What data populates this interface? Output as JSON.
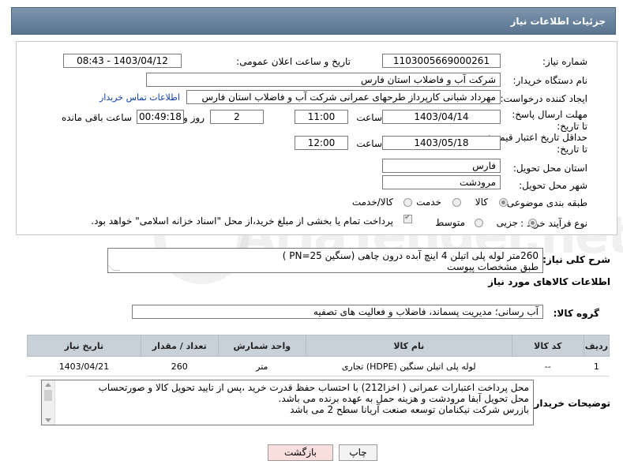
{
  "header": {
    "title": "جزئیات اطلاعات نیاز"
  },
  "form": {
    "need_number_label": "شماره نیاز:",
    "need_number": "1103005669000261",
    "announce_label": "تاریخ و ساعت اعلان عمومی:",
    "announce_value": "1403/04/12 - 08:43",
    "buyer_org_label": "نام دستگاه خریدار:",
    "buyer_org": "شرکت آب و فاضلاب استان فارس",
    "requester_label": "ایجاد کننده درخواست:",
    "requester": "مهرداد شبانی کارپرداز طرحهای عمرانی  شرکت آب و فاضلاب استان فارس",
    "contact_link": "اطلاعات تماس خریدار",
    "reply_deadline_label": "مهلت ارسال پاسخ: تا تاریخ:",
    "reply_date": "1403/04/14",
    "time_label": "ساعت",
    "reply_time": "11:00",
    "days_value": "2",
    "days_label": "روز و",
    "remaining_time": "00:49:18",
    "remaining_label": "ساعت باقی مانده",
    "validity_label": "حداقل تاریخ اعتبار قیمت: تا تاریخ:",
    "validity_date": "1403/05/18",
    "validity_time_label": "ساعت",
    "validity_time": "12:00",
    "province_label": "استان محل تحویل:",
    "province": "فارس",
    "city_label": "شهر محل تحویل:",
    "city": "مرودشت",
    "category_label": "طبقه بندی موضوعی:",
    "category_options": [
      "کالا",
      "خدمت",
      "کالا/خدمت"
    ],
    "process_label": "نوع فرآیند خرید :",
    "process_options": [
      "جزیی",
      "متوسط"
    ],
    "payment_note": "پرداخت تمام یا بخشی از مبلغ خرید،از محل \"اسناد خزانه اسلامی\" خواهد بود."
  },
  "description": {
    "label": "شرح کلی نیاز:",
    "text_line1": "260متر لوله پلی اتیلن 4 اینچ  آبده درون چاهی (سنگین PN=25 )",
    "text_line2": "طبق مشخصات پیوست"
  },
  "goods": {
    "section_title": "اطلاعات کالاهای مورد نیاز",
    "group_label": "گروه کالا:",
    "group_value": "آب رسانی؛ مدیریت پسماند، فاضلاب و فعالیت های تصفیه",
    "columns": [
      "ردیف",
      "کد کالا",
      "نام کالا",
      "واحد شمارش",
      "تعداد / مقدار",
      "تاریخ نیاز"
    ],
    "rows": [
      {
        "row": "1",
        "code": "--",
        "name": "لوله پلی اتیلن سنگین (HDPE) تجاری",
        "unit": "متر",
        "qty": "260",
        "date": "1403/04/21"
      }
    ]
  },
  "buyer_notes": {
    "label": "توضیحات خریدار:",
    "line1": "محل پرداخت اعتبارات عمرانی ( اخزا212)  با احتساب حفظ قدرت خرید ،پس از تایید تحویل کالا و صورتحساب",
    "line2": "محل تحویل  آبفا مرودشت  و هزینه حمل به عهده برنده می باشد.",
    "line3": "بازرس شرکت نیکنامان توسعه صنعت آریانا سطح 2 می باشد"
  },
  "buttons": {
    "print": "چاپ",
    "back": "بازگشت"
  },
  "watermark": "AriaTender.net",
  "colors": {
    "header_bg": "#6b849d",
    "table_header_bg": "#c8d0d8",
    "link": "#0b3fae",
    "back_button_bg": "#f9dede"
  }
}
